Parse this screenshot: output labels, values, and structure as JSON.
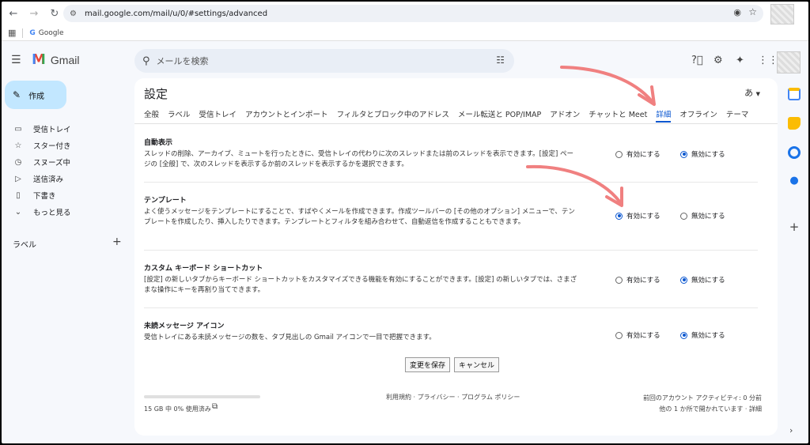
{
  "browser": {
    "url": "mail.google.com/mail/u/0/#settings/advanced",
    "bookmark_label": "Google"
  },
  "header": {
    "app_name": "Gmail",
    "search_placeholder": "メールを検索"
  },
  "sidebar": {
    "compose_label": "作成",
    "items": [
      {
        "icon": "inbox-icon",
        "label": "受信トレイ"
      },
      {
        "icon": "star-icon",
        "label": "スター付き"
      },
      {
        "icon": "clock-icon",
        "label": "スヌーズ中"
      },
      {
        "icon": "send-icon",
        "label": "送信済み"
      },
      {
        "icon": "draft-icon",
        "label": "下書き"
      },
      {
        "icon": "chevron-down-icon",
        "label": "もっと見る"
      }
    ],
    "labels_heading": "ラベル"
  },
  "settings": {
    "title": "設定",
    "lang_indicator": "あ",
    "tabs": [
      "全般",
      "ラベル",
      "受信トレイ",
      "アカウントとインポート",
      "フィルタとブロック中のアドレス",
      "メール転送と POP/IMAP",
      "アドオン",
      "チャットと Meet",
      "詳細",
      "オフライン",
      "テーマ"
    ],
    "active_tab_index": 8,
    "enable_label": "有効にする",
    "disable_label": "無効にする",
    "rows": [
      {
        "title": "自動表示",
        "desc": "スレッドの削除、アーカイブ、ミュートを行ったときに、受信トレイの代わりに次のスレッドまたは前のスレッドを表示できます。[設定] ページの [全般] で、次のスレッドを表示するか前のスレッドを表示するかを選択できます。",
        "selected": "disable"
      },
      {
        "title": "テンプレート",
        "desc": "よく使うメッセージをテンプレートにすることで、すばやくメールを作成できます。作成ツールバーの [その他のオプション] メニューで、テンプレートを作成したり、挿入したりできます。テンプレートとフィルタを組み合わせて、自動返信を作成することもできます。",
        "selected": "enable"
      },
      {
        "title": "カスタム キーボード ショートカット",
        "desc": "[設定] の新しいタブからキーボード ショートカットをカスタマイズできる機能を有効にすることができます。[設定] の新しいタブでは、さまざまな操作にキーを再割り当てできます。",
        "selected": "disable"
      },
      {
        "title": "未読メッセージ アイコン",
        "desc": "受信トレイにある未読メッセージの数を、タブ見出しの Gmail アイコンで一目で把握できます。",
        "selected": "disable"
      }
    ],
    "save_label": "変更を保存",
    "cancel_label": "キャンセル"
  },
  "footer": {
    "storage": "15 GB 中 0% 使用済み",
    "storage_used_fraction": 0.0,
    "links": "利用規約 · プライバシー · プログラム ポリシー",
    "activity_line1": "前回のアカウント アクティビティ: 0 分前",
    "activity_line2": "他の 1 か所で開かれています · 詳細"
  },
  "colors": {
    "accent": "#0b57d0",
    "compose_bg": "#c2e7ff",
    "annotation_arrow": "#f08080"
  }
}
